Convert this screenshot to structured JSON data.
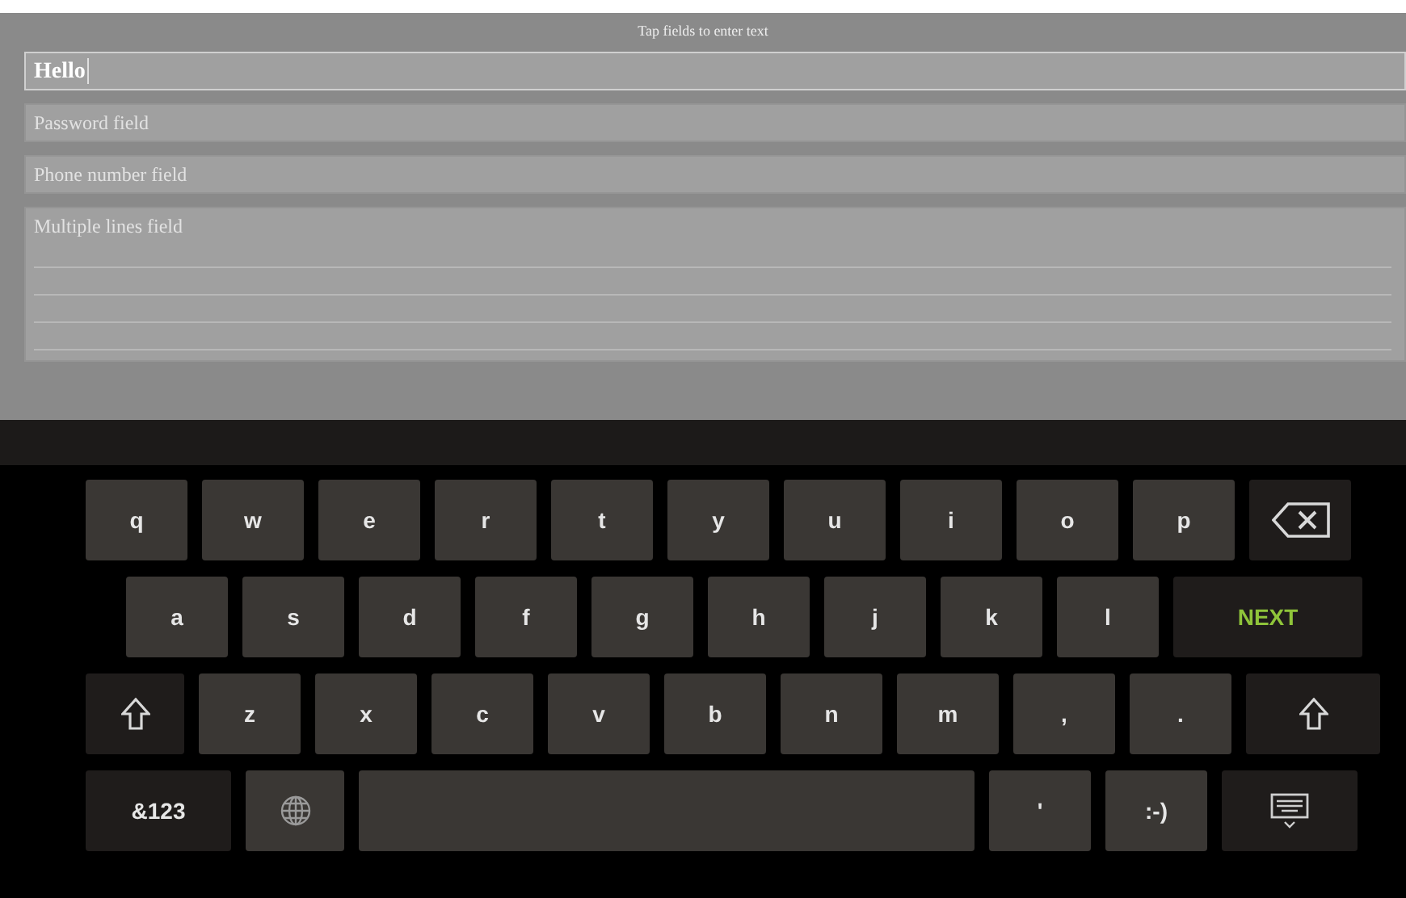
{
  "header": {
    "title": "Tap fields to enter text"
  },
  "fields": [
    {
      "kind": "single",
      "value": "Hello",
      "focused": true
    },
    {
      "kind": "single",
      "placeholder": "Password field",
      "focused": false
    },
    {
      "kind": "single",
      "placeholder": "Phone number field",
      "focused": false
    },
    {
      "kind": "multi",
      "placeholder": "Multiple lines field",
      "focused": false
    }
  ],
  "keyboard": {
    "rows": [
      [
        {
          "kind": "letter",
          "label": "q"
        },
        {
          "kind": "letter",
          "label": "w"
        },
        {
          "kind": "letter",
          "label": "e"
        },
        {
          "kind": "letter",
          "label": "r"
        },
        {
          "kind": "letter",
          "label": "t"
        },
        {
          "kind": "letter",
          "label": "y"
        },
        {
          "kind": "letter",
          "label": "u"
        },
        {
          "kind": "letter",
          "label": "i"
        },
        {
          "kind": "letter",
          "label": "o"
        },
        {
          "kind": "letter",
          "label": "p"
        },
        {
          "kind": "backspace"
        }
      ],
      [
        {
          "kind": "letter",
          "label": "a"
        },
        {
          "kind": "letter",
          "label": "s"
        },
        {
          "kind": "letter",
          "label": "d"
        },
        {
          "kind": "letter",
          "label": "f"
        },
        {
          "kind": "letter",
          "label": "g"
        },
        {
          "kind": "letter",
          "label": "h"
        },
        {
          "kind": "letter",
          "label": "j"
        },
        {
          "kind": "letter",
          "label": "k"
        },
        {
          "kind": "letter",
          "label": "l"
        },
        {
          "kind": "action",
          "label": "NEXT"
        }
      ],
      [
        {
          "kind": "shift"
        },
        {
          "kind": "letter",
          "label": "z"
        },
        {
          "kind": "letter",
          "label": "x"
        },
        {
          "kind": "letter",
          "label": "c"
        },
        {
          "kind": "letter",
          "label": "v"
        },
        {
          "kind": "letter",
          "label": "b"
        },
        {
          "kind": "letter",
          "label": "n"
        },
        {
          "kind": "letter",
          "label": "m"
        },
        {
          "kind": "letter",
          "label": ","
        },
        {
          "kind": "letter",
          "label": "."
        },
        {
          "kind": "shift_wide"
        }
      ],
      [
        {
          "kind": "symbols",
          "label": "&123"
        },
        {
          "kind": "globe"
        },
        {
          "kind": "space"
        },
        {
          "kind": "letter",
          "label": "'"
        },
        {
          "kind": "letter",
          "label": ":-)"
        },
        {
          "kind": "hide"
        }
      ]
    ]
  }
}
